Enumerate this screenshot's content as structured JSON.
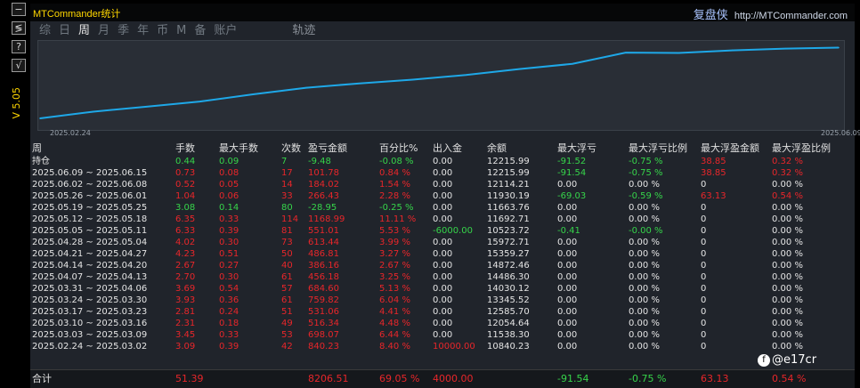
{
  "window": {
    "app_title": "MTCommander统计",
    "brand_cn": "复盘侠",
    "brand_url": "http://MTCommander.com"
  },
  "left_toolbar": {
    "buttons": [
      "−",
      "≶",
      "?",
      "√"
    ],
    "vertical_label": "V 5.05"
  },
  "tabs": [
    "综",
    "日",
    "周",
    "月",
    "季",
    "年",
    "币",
    "M",
    "备",
    "账户",
    "轨迹"
  ],
  "selected_tab": "周",
  "equity_chart": {
    "start_date": "2025.02.24",
    "end_date": "2025.06.09",
    "line_color": "#1ea8e8"
  },
  "chart_data": {
    "type": "line",
    "title": "",
    "xlabel": "",
    "ylabel": "",
    "x": [
      "2025.02.24",
      "2025.03.03",
      "2025.03.10",
      "2025.03.17",
      "2025.03.24",
      "2025.03.31",
      "2025.04.07",
      "2025.04.14",
      "2025.04.21",
      "2025.04.28",
      "2025.05.05",
      "2025.05.12",
      "2025.05.19",
      "2025.05.26",
      "2025.06.02",
      "2025.06.09"
    ],
    "series": [
      {
        "values": [
          840,
          1537,
          2054,
          2586,
          3346,
          4030,
          4486,
          4873,
          5359,
          5973,
          6524,
          7693,
          7664,
          7930,
          8114,
          8215
        ]
      }
    ]
  },
  "table": {
    "headers": [
      "周",
      "手数",
      "最大手数",
      "次数",
      "盈亏金额",
      "百分比%",
      "出入金",
      "余额",
      "最大浮亏",
      "最大浮亏比例",
      "最大浮盈金额",
      "最大浮盈比例"
    ],
    "holding": {
      "label": "持仓",
      "cells": [
        "0.44",
        "0.09",
        "7",
        "-9.48",
        "-0.08 %",
        "0.00",
        "12215.99",
        "-91.52",
        "-0.75 %",
        "38.85",
        "0.32 %"
      ],
      "colors": [
        "pos",
        "pos",
        "pos",
        "pos",
        "pos",
        "wh",
        "wh",
        "pos",
        "pos",
        "neg",
        "neg"
      ]
    },
    "rows": [
      {
        "week": "2025.06.09 ~ 2025.06.15",
        "lots": "0.73",
        "maxlots": "0.08",
        "count": "17",
        "pnl": "101.78",
        "pct": "0.84 %",
        "flow": "0.00",
        "balance": "12215.99",
        "maxdd": "-91.54",
        "maxddpct": "-0.75 %",
        "maxfp": "38.85",
        "maxfppct": "0.32 %",
        "tone": "neg",
        "ddtone": "pos",
        "fptone": "neg",
        "flowtone": "wh"
      },
      {
        "week": "2025.06.02 ~ 2025.06.08",
        "lots": "0.52",
        "maxlots": "0.05",
        "count": "14",
        "pnl": "184.02",
        "pct": "1.54 %",
        "flow": "0.00",
        "balance": "12114.21",
        "maxdd": "0.00",
        "maxddpct": "0.00 %",
        "maxfp": "0",
        "maxfppct": "0.00 %",
        "tone": "neg",
        "ddtone": "wh",
        "fptone": "wh",
        "flowtone": "wh"
      },
      {
        "week": "2025.05.26 ~ 2025.06.01",
        "lots": "1.04",
        "maxlots": "0.06",
        "count": "33",
        "pnl": "266.43",
        "pct": "2.28 %",
        "flow": "0.00",
        "balance": "11930.19",
        "maxdd": "-69.03",
        "maxddpct": "-0.59 %",
        "maxfp": "63.13",
        "maxfppct": "0.54 %",
        "tone": "neg",
        "ddtone": "pos",
        "fptone": "neg",
        "flowtone": "wh"
      },
      {
        "week": "2025.05.19 ~ 2025.05.25",
        "lots": "3.08",
        "maxlots": "0.14",
        "count": "80",
        "pnl": "-28.95",
        "pct": "-0.25 %",
        "flow": "0.00",
        "balance": "11663.76",
        "maxdd": "0.00",
        "maxddpct": "0.00 %",
        "maxfp": "0",
        "maxfppct": "0.00 %",
        "tone": "pos",
        "ddtone": "wh",
        "fptone": "wh",
        "flowtone": "wh"
      },
      {
        "week": "2025.05.12 ~ 2025.05.18",
        "lots": "6.35",
        "maxlots": "0.33",
        "count": "114",
        "pnl": "1168.99",
        "pct": "11.11 %",
        "flow": "0.00",
        "balance": "11692.71",
        "maxdd": "0.00",
        "maxddpct": "0.00 %",
        "maxfp": "0",
        "maxfppct": "0.00 %",
        "tone": "neg",
        "ddtone": "wh",
        "fptone": "wh",
        "flowtone": "wh"
      },
      {
        "week": "2025.05.05 ~ 2025.05.11",
        "lots": "6.33",
        "maxlots": "0.39",
        "count": "81",
        "pnl": "551.01",
        "pct": "5.53 %",
        "flow": "-6000.00",
        "balance": "10523.72",
        "maxdd": "-0.41",
        "maxddpct": "-0.00 %",
        "maxfp": "0",
        "maxfppct": "0.00 %",
        "tone": "neg",
        "ddtone": "pos",
        "fptone": "wh",
        "flowtone": "pos"
      },
      {
        "week": "2025.04.28 ~ 2025.05.04",
        "lots": "4.02",
        "maxlots": "0.30",
        "count": "73",
        "pnl": "613.44",
        "pct": "3.99 %",
        "flow": "0.00",
        "balance": "15972.71",
        "maxdd": "0.00",
        "maxddpct": "0.00 %",
        "maxfp": "0",
        "maxfppct": "0.00 %",
        "tone": "neg",
        "ddtone": "wh",
        "fptone": "wh",
        "flowtone": "wh"
      },
      {
        "week": "2025.04.21 ~ 2025.04.27",
        "lots": "4.23",
        "maxlots": "0.51",
        "count": "50",
        "pnl": "486.81",
        "pct": "3.27 %",
        "flow": "0.00",
        "balance": "15359.27",
        "maxdd": "0.00",
        "maxddpct": "0.00 %",
        "maxfp": "0",
        "maxfppct": "0.00 %",
        "tone": "neg",
        "ddtone": "wh",
        "fptone": "wh",
        "flowtone": "wh"
      },
      {
        "week": "2025.04.14 ~ 2025.04.20",
        "lots": "2.67",
        "maxlots": "0.27",
        "count": "40",
        "pnl": "386.16",
        "pct": "2.67 %",
        "flow": "0.00",
        "balance": "14872.46",
        "maxdd": "0.00",
        "maxddpct": "0.00 %",
        "maxfp": "0",
        "maxfppct": "0.00 %",
        "tone": "neg",
        "ddtone": "wh",
        "fptone": "wh",
        "flowtone": "wh"
      },
      {
        "week": "2025.04.07 ~ 2025.04.13",
        "lots": "2.70",
        "maxlots": "0.30",
        "count": "61",
        "pnl": "456.18",
        "pct": "3.25 %",
        "flow": "0.00",
        "balance": "14486.30",
        "maxdd": "0.00",
        "maxddpct": "0.00 %",
        "maxfp": "0",
        "maxfppct": "0.00 %",
        "tone": "neg",
        "ddtone": "wh",
        "fptone": "wh",
        "flowtone": "wh"
      },
      {
        "week": "2025.03.31 ~ 2025.04.06",
        "lots": "3.69",
        "maxlots": "0.54",
        "count": "57",
        "pnl": "684.60",
        "pct": "5.13 %",
        "flow": "0.00",
        "balance": "14030.12",
        "maxdd": "0.00",
        "maxddpct": "0.00 %",
        "maxfp": "0",
        "maxfppct": "0.00 %",
        "tone": "neg",
        "ddtone": "wh",
        "fptone": "wh",
        "flowtone": "wh"
      },
      {
        "week": "2025.03.24 ~ 2025.03.30",
        "lots": "3.93",
        "maxlots": "0.36",
        "count": "61",
        "pnl": "759.82",
        "pct": "6.04 %",
        "flow": "0.00",
        "balance": "13345.52",
        "maxdd": "0.00",
        "maxddpct": "0.00 %",
        "maxfp": "0",
        "maxfppct": "0.00 %",
        "tone": "neg",
        "ddtone": "wh",
        "fptone": "wh",
        "flowtone": "wh"
      },
      {
        "week": "2025.03.17 ~ 2025.03.23",
        "lots": "2.81",
        "maxlots": "0.24",
        "count": "51",
        "pnl": "531.06",
        "pct": "4.41 %",
        "flow": "0.00",
        "balance": "12585.70",
        "maxdd": "0.00",
        "maxddpct": "0.00 %",
        "maxfp": "0",
        "maxfppct": "0.00 %",
        "tone": "neg",
        "ddtone": "wh",
        "fptone": "wh",
        "flowtone": "wh"
      },
      {
        "week": "2025.03.10 ~ 2025.03.16",
        "lots": "2.31",
        "maxlots": "0.18",
        "count": "49",
        "pnl": "516.34",
        "pct": "4.48 %",
        "flow": "0.00",
        "balance": "12054.64",
        "maxdd": "0.00",
        "maxddpct": "0.00 %",
        "maxfp": "0",
        "maxfppct": "0.00 %",
        "tone": "neg",
        "ddtone": "wh",
        "fptone": "wh",
        "flowtone": "wh"
      },
      {
        "week": "2025.03.03 ~ 2025.03.09",
        "lots": "3.45",
        "maxlots": "0.33",
        "count": "53",
        "pnl": "698.07",
        "pct": "6.44 %",
        "flow": "0.00",
        "balance": "11538.30",
        "maxdd": "0.00",
        "maxddpct": "0.00 %",
        "maxfp": "0",
        "maxfppct": "0.00 %",
        "tone": "neg",
        "ddtone": "wh",
        "fptone": "wh",
        "flowtone": "wh"
      },
      {
        "week": "2025.02.24 ~ 2025.03.02",
        "lots": "3.09",
        "maxlots": "0.39",
        "count": "42",
        "pnl": "840.23",
        "pct": "8.40 %",
        "flow": "10000.00",
        "balance": "10840.23",
        "maxdd": "0.00",
        "maxddpct": "0.00 %",
        "maxfp": "0",
        "maxfppct": "0.00 %",
        "tone": "neg",
        "ddtone": "wh",
        "fptone": "wh",
        "flowtone": "neg"
      }
    ],
    "total": {
      "label": "合计",
      "lots": "51.39",
      "pnl": "8206.51",
      "pct": "69.05 %",
      "flow": "4000.00",
      "maxdd": "-91.54",
      "maxddpct": "-0.75 %",
      "maxfp": "63.13",
      "maxfppct": "0.54 %"
    }
  },
  "watermark": "@e17cr",
  "colors": {
    "positive": "#36d44a",
    "negative": "#e8262a",
    "title": "#ffd700"
  }
}
